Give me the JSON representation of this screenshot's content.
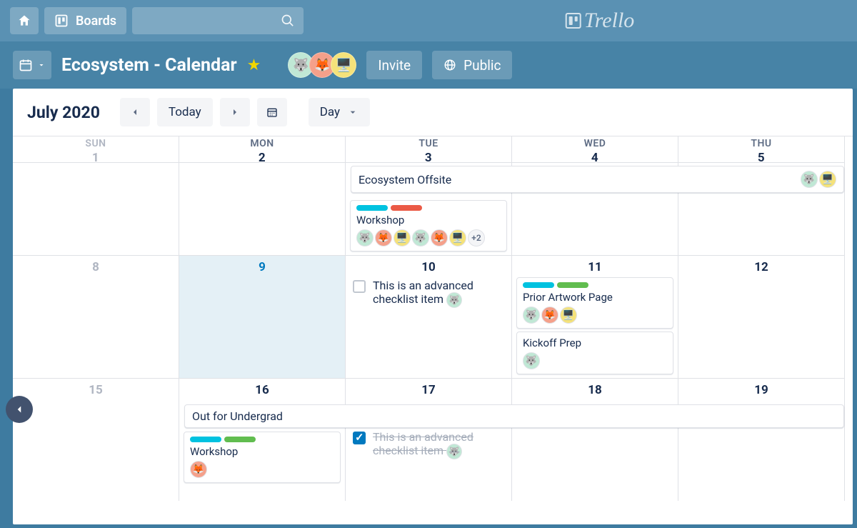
{
  "nav": {
    "boards_label": "Boards",
    "logo": "Trello"
  },
  "board": {
    "title": "Ecosystem - Calendar",
    "invite": "Invite",
    "visibility": "Public"
  },
  "toolbar": {
    "month_label": "July 2020",
    "today": "Today",
    "view": "Day"
  },
  "days": {
    "sun": "SUN",
    "mon": "MON",
    "tue": "TUE",
    "wed": "WED",
    "thu": "THU",
    "d1": "1",
    "d2": "2",
    "d3": "3",
    "d4": "4",
    "d5": "5",
    "d8": "8",
    "d9": "9",
    "d10": "10",
    "d11": "11",
    "d12": "12",
    "d15": "15",
    "d16": "16",
    "d17": "17",
    "d18": "18",
    "d19": "19"
  },
  "events": {
    "offsite": "Ecosystem Offsite",
    "workshop": "Workshop",
    "workshop_more": "+2",
    "checklist": "This is an advanced checklist item",
    "prior_artwork": "Prior Artwork Page",
    "kickoff": "Kickoff Prep",
    "undergrad": "Out for Undergrad"
  },
  "avatars": {
    "husky": "🐺",
    "fox": "🦊",
    "robot": "🖥️"
  }
}
